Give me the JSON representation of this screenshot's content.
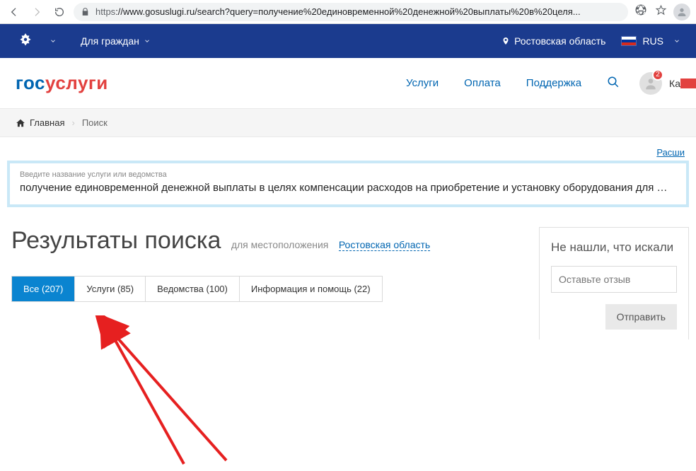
{
  "browser": {
    "url_prefix_scheme": "https",
    "url_rest": "://www.gosuslugi.ru/search?query=получение%20единовременной%20денежной%20выплаты%20в%20целя..."
  },
  "topbar": {
    "audience": "Для граждан",
    "region": "Ростовская область",
    "lang": "RUS"
  },
  "header": {
    "logo_part1": "гос",
    "logo_part2": "услуги",
    "nav": {
      "services": "Услуги",
      "payment": "Оплата",
      "support": "Поддержка"
    },
    "badge": "2",
    "user_partial": "Ка"
  },
  "breadcrumb": {
    "home": "Главная",
    "current": "Поиск"
  },
  "search": {
    "extend": "Расши",
    "label": "Введите название услуги или ведомства",
    "value": "получение единовременной денежной выплаты в целях компенсации расходов на приобретение и установку оборудования для …"
  },
  "results": {
    "title": "Результаты поиска",
    "for_location": "для местоположения",
    "location": "Ростовская область"
  },
  "tabs": {
    "all": "Все (207)",
    "services": "Услуги (85)",
    "agencies": "Ведомства (100)",
    "info": "Информация и помощь (22)"
  },
  "feedback": {
    "title": "Не нашли, что искали",
    "placeholder": "Оставьте отзыв",
    "submit": "Отправить"
  }
}
